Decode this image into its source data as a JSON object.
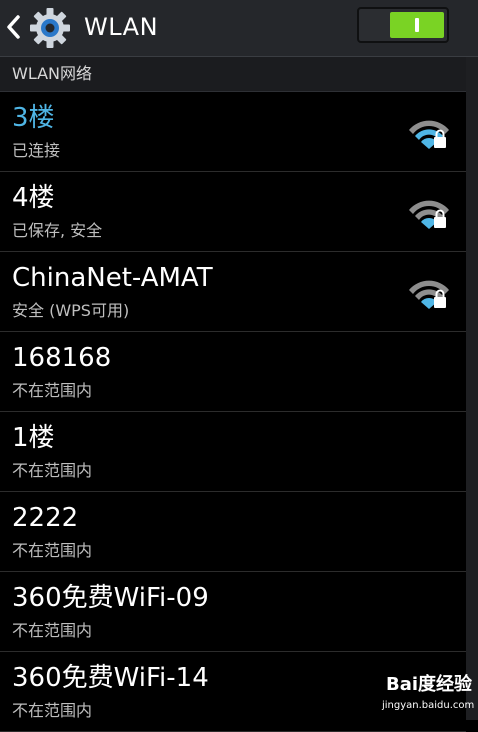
{
  "header": {
    "title": "WLAN",
    "toggle_on": true
  },
  "section": {
    "title": "WLAN网络"
  },
  "networks": [
    {
      "name": "3楼",
      "status": "已连接",
      "connected": true,
      "secured": true
    },
    {
      "name": "4楼",
      "status": "已保存, 安全",
      "connected": false,
      "secured": true
    },
    {
      "name": "ChinaNet-AMAT",
      "status": "安全 (WPS可用)",
      "connected": false,
      "secured": true
    },
    {
      "name": "168168",
      "status": "不在范围内",
      "connected": false,
      "secured": false
    },
    {
      "name": "1楼",
      "status": "不在范围内",
      "connected": false,
      "secured": false
    },
    {
      "name": "2222",
      "status": "不在范围内",
      "connected": false,
      "secured": false
    },
    {
      "name": "360免费WiFi-09",
      "status": "不在范围内",
      "connected": false,
      "secured": false
    },
    {
      "name": "360免费WiFi-14",
      "status": "不在范围内",
      "connected": false,
      "secured": false
    }
  ],
  "watermark": {
    "brand": "Bai度经验",
    "url": "jingyan.baidu.com"
  },
  "colors": {
    "accent": "#4fb5e5",
    "toggle_on": "#7ad324",
    "header_bg": "#25272b"
  },
  "icons": {
    "back": "chevron-left-icon",
    "settings": "gear-icon",
    "wifi": "wifi-lock-icon"
  }
}
